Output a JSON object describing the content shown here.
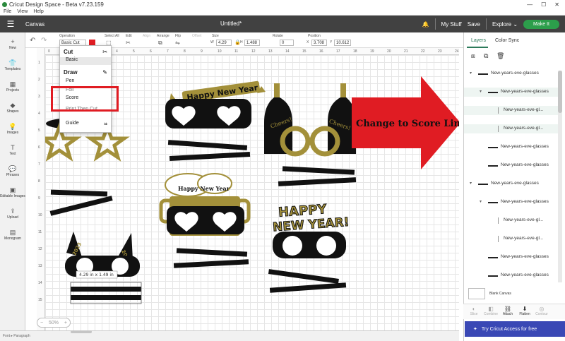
{
  "titlebar": {
    "title": "Cricut Design Space - Beta v7.23.159",
    "min": "—",
    "max": "☐",
    "close": "✕"
  },
  "menu": [
    "File",
    "View",
    "Help"
  ],
  "header": {
    "canvas_label": "Canvas",
    "doc_title": "Untitled*",
    "my_stuff": "My Stuff",
    "save": "Save",
    "explore": "Explore",
    "make_it": "Make It"
  },
  "leftbar": [
    {
      "label": "New",
      "icon": "plus-icon",
      "glyph": "+"
    },
    {
      "label": "Templates",
      "icon": "shirt-icon",
      "glyph": "👕"
    },
    {
      "label": "Projects",
      "icon": "grid-icon",
      "glyph": "▦"
    },
    {
      "label": "Shapes",
      "icon": "shapes-icon",
      "glyph": "◆"
    },
    {
      "label": "Images",
      "icon": "bulb-icon",
      "glyph": "💡"
    },
    {
      "label": "Text",
      "icon": "text-icon",
      "glyph": "T"
    },
    {
      "label": "Phrases",
      "icon": "chat-icon",
      "glyph": "💬"
    },
    {
      "label": "Editable Images",
      "icon": "image-edit-icon",
      "glyph": "▣"
    },
    {
      "label": "Upload",
      "icon": "upload-icon",
      "glyph": "⇪"
    },
    {
      "label": "Monogram",
      "icon": "monogram-icon",
      "glyph": "▤"
    }
  ],
  "toolbar": {
    "operation_label": "Operation",
    "operation_value": "Basic Cut",
    "select_all": "Select All",
    "edit": "Edit",
    "align": "Align",
    "arrange": "Arrange",
    "flip": "Flip",
    "offset": "Offset",
    "size": "Size",
    "w_label": "W",
    "w_value": "4.29",
    "h_label": "H",
    "h_value": "1.488",
    "rotate": "Rotate",
    "rotate_value": "0",
    "position": "Position",
    "x_label": "X",
    "x_value": "3.708",
    "y_label": "Y",
    "y_value": "10.612"
  },
  "ruler": {
    "top": [
      "0",
      "1",
      "2",
      "3",
      "4",
      "5",
      "6",
      "7",
      "8",
      "9",
      "10",
      "11",
      "12",
      "13",
      "14",
      "15",
      "16",
      "17",
      "18",
      "19",
      "20",
      "21",
      "22",
      "23",
      "24"
    ],
    "left": [
      "1",
      "2",
      "3",
      "4",
      "5",
      "6",
      "7",
      "8",
      "9",
      "10",
      "11",
      "12",
      "13",
      "14",
      "15"
    ]
  },
  "dropdown": {
    "cut_header": "Cut",
    "basic": "Basic",
    "draw_header": "Draw",
    "pen": "Pen",
    "foil": "Foil",
    "score": "Score",
    "print_then_cut": "Print Then Cut",
    "guide": "Guide"
  },
  "canvas_art": {
    "happy_new_year_top": "Happy New Year",
    "cheers_left": "Cheers!",
    "cheers_right": "Cheers!",
    "happy_new_year_beer": "Happy New Year",
    "happy_big": "HAPPY",
    "new_year_big": "NEW YEAR!",
    "year_left": "2023",
    "year_right": "2023",
    "size_readout": "4.29 in x 1.49 in"
  },
  "annotation": {
    "text": "Change to Score Lines",
    "color": "#e01c23"
  },
  "right_panel": {
    "tab_layers": "Layers",
    "tab_color_sync": "Color Sync",
    "layers": [
      {
        "name": "New-years-eve-glasses",
        "level": 0,
        "chevron": "▾",
        "selected": false
      },
      {
        "name": "New-years-eve-glasses",
        "level": 1,
        "chevron": "▾",
        "selected": true
      },
      {
        "name": "New-years-eve-gl...",
        "level": 2,
        "chevron": "",
        "selected": true
      },
      {
        "name": "New-years-eve-gl...",
        "level": 2,
        "chevron": "",
        "selected": true
      },
      {
        "name": "New-years-eve-glasses",
        "level": 1,
        "chevron": "",
        "selected": false
      },
      {
        "name": "New-years-eve-glasses",
        "level": 1,
        "chevron": "",
        "selected": false
      },
      {
        "name": "New-years-eve-glasses",
        "level": 0,
        "chevron": "▾",
        "selected": false
      },
      {
        "name": "New-years-eve-glasses",
        "level": 1,
        "chevron": "▾",
        "selected": false
      },
      {
        "name": "New-years-eve-gl...",
        "level": 2,
        "chevron": "",
        "selected": false
      },
      {
        "name": "New-years-eve-gl...",
        "level": 2,
        "chevron": "",
        "selected": false
      },
      {
        "name": "New-years-eve-glasses",
        "level": 1,
        "chevron": "",
        "selected": false
      },
      {
        "name": "New-years-eve-glasses",
        "level": 1,
        "chevron": "",
        "selected": false
      }
    ],
    "blank_canvas": "Blank Canvas",
    "actions": [
      "Slice",
      "Combine",
      "Attach",
      "Flatten",
      "Contour"
    ],
    "access_button": "Try Cricut Access for free"
  },
  "status": {
    "zoom": "50%",
    "minus": "−",
    "plus": "+",
    "bottom_text": "Font  ▸  Paragraph"
  },
  "colors": {
    "gold": "#a3903a",
    "black": "#111111",
    "header": "#414141",
    "accent_green": "#2c9e4b",
    "access_blue": "#3a48b5",
    "highlight_red": "#e01c23"
  }
}
